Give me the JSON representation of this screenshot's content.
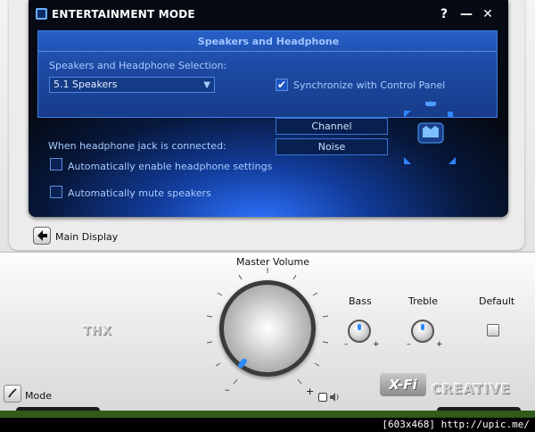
{
  "window": {
    "title": "ENTERTAINMENT MODE",
    "help": "?",
    "minimize": "—",
    "close": "✕"
  },
  "panel": {
    "title": "Speakers and Headphone",
    "selection_label": "Speakers and Headphone Selection:",
    "selection_value": "5.1 Speakers",
    "sync_label": "Synchronize with Control Panel",
    "sync_checked": true,
    "channel_button": "Channel",
    "noise_button": "Noise"
  },
  "headphone": {
    "jack_label": "When headphone jack is connected:",
    "auto_enable_label": "Automatically enable headphone settings",
    "auto_mute_label": "Automatically mute speakers"
  },
  "nav": {
    "main_display": "Main Display",
    "mode": "Mode"
  },
  "console": {
    "master_volume": "Master Volume",
    "bass": "Bass",
    "treble": "Treble",
    "default": "Default",
    "thx": "THX",
    "minus": "–",
    "plus": "+",
    "xfi": "X-Fi",
    "brand": "CREATIVE"
  },
  "watermark": "[603x468] http://upic.me/",
  "colors": {
    "accent": "#2f73ff",
    "panel": "#1d4aa4",
    "dark": "#050a14"
  }
}
